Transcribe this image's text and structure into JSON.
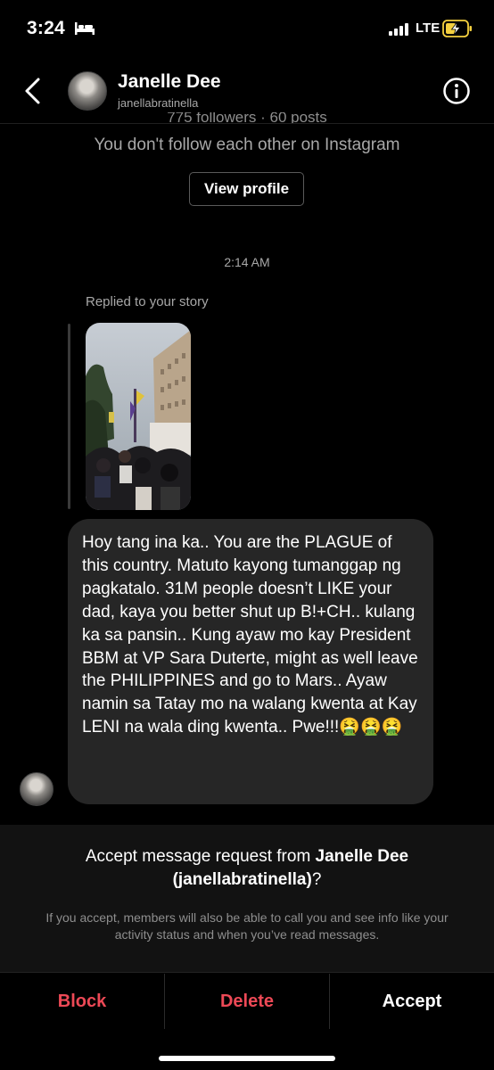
{
  "status": {
    "time": "3:24",
    "network": "LTE"
  },
  "header": {
    "name": "Janelle Dee",
    "handle": "janellabratinella"
  },
  "profile": {
    "stats_cut": "775 followers · 60 posts",
    "follow_status": "You don't follow each other on Instagram",
    "view_profile": "View profile"
  },
  "thread": {
    "timestamp": "2:14 AM",
    "replied_label": "Replied to your story",
    "message": "Hoy tang ina ka.. You are the PLAGUE of this country. Matuto kayong tumanggap ng pagkatalo. 31M people doesn’t LIKE your dad, kaya you better shut up B!+CH.. kulang ka sa pansin.. Kung ayaw mo kay President BBM at VP Sara Duterte, might as well leave the PHILIPPINES and go to Mars.. Ayaw namin sa Tatay mo na walang kwenta at Kay LENI na wala ding kwenta.. Pwe!!!🤮🤮🤮"
  },
  "request": {
    "title_prefix": "Accept message request from ",
    "title_name": "Janelle Dee",
    "title_handle": "(janellabratinella)",
    "title_suffix": "?",
    "description": "If you accept, members will also be able to call you and see info like your activity status and when you’ve read messages."
  },
  "actions": {
    "block": "Block",
    "delete": "Delete",
    "accept": "Accept"
  },
  "colors": {
    "danger": "#ed4956",
    "bubble": "#262626",
    "panel": "#121212",
    "battery": "#f4d03f"
  },
  "icons": [
    "bed-icon",
    "signal-icon",
    "battery-charging-icon",
    "back-chevron-icon",
    "info-icon"
  ]
}
